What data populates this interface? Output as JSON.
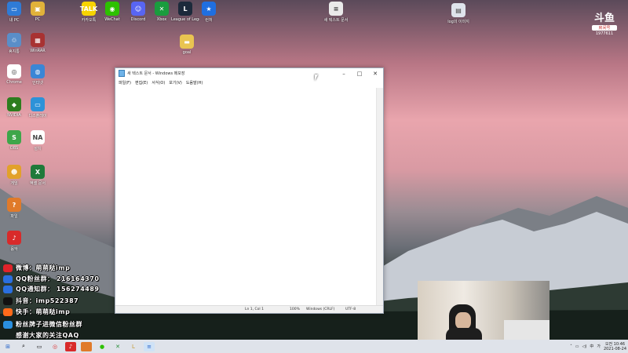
{
  "desktop_icons": [
    {
      "label": "내 PC",
      "color": "#2f7bd6",
      "glyph": "▭"
    },
    {
      "label": "PC",
      "color": "#e1b23a",
      "glyph": "▣"
    },
    {
      "label": "카카오톡",
      "color": "#f7d400",
      "glyph": "TALK"
    },
    {
      "label": "WeChat",
      "color": "#2dc100",
      "glyph": "◉"
    },
    {
      "label": "Discord",
      "color": "#5865f2",
      "glyph": "☺"
    },
    {
      "label": "Xbox",
      "color": "#1a9c3e",
      "glyph": "✕"
    },
    {
      "label": "League of Legends",
      "color": "#1c2a3b",
      "glyph": "L"
    },
    {
      "label": "런처",
      "color": "#1f6fe0",
      "glyph": "★"
    },
    {
      "label": "새 텍스트 문서",
      "color": "#eaeaea",
      "glyph": "≡"
    },
    {
      "label": "log의 이미지",
      "color": "#dfe4ec",
      "glyph": "▤"
    },
    {
      "label": "휴지통",
      "color": "#5a8ec8",
      "glyph": "♲"
    },
    {
      "label": "WinRAR",
      "color": "#a83232",
      "glyph": "▦"
    },
    {
      "label": "goal",
      "color": "#e9c451",
      "glyph": "▬"
    },
    {
      "label": "Chrome",
      "color": "#ffffff",
      "glyph": "◎"
    },
    {
      "label": "인터넷",
      "color": "#3a86d6",
      "glyph": "◍"
    },
    {
      "label": "NVIDIA",
      "color": "#2d7d1e",
      "glyph": "◆"
    },
    {
      "label": "디스플레이",
      "color": "#2d92d8",
      "glyph": "▭"
    },
    {
      "label": "OBS",
      "color": "#3ea64a",
      "glyph": "S"
    },
    {
      "label": "설치",
      "color": "#ffffff",
      "glyph": "NA"
    },
    {
      "label": "게임",
      "color": "#e2a12a",
      "glyph": "☻"
    },
    {
      "label": "엑셀 문서",
      "color": "#1f7a3a",
      "glyph": "X"
    },
    {
      "label": "파일",
      "color": "#e07a2a",
      "glyph": "?"
    },
    {
      "label": "음악",
      "color": "#d82a2a",
      "glyph": "♪"
    }
  ],
  "notepad": {
    "title": "새 텍스트 문서 - Windows 메모장",
    "menu": [
      "파일(F)",
      "편집(E)",
      "서식(O)",
      "보기(V)",
      "도움말(H)"
    ],
    "status": {
      "position": "Ln 1, Col 1",
      "zoom": "100%",
      "eol": "Windows (CRLF)",
      "encoding": "UTF-8"
    }
  },
  "overlay": [
    {
      "icon_color": "#e0232a",
      "text": "微博：萌萌哒imp"
    },
    {
      "icon_color": "#2a6fe0",
      "text": "QQ粉丝群： 216164370"
    },
    {
      "icon_color": "#2a6fe0",
      "text": "QQ通知群： 156274489"
    },
    {
      "icon_color": "#111111",
      "text": "抖音：imp522387"
    },
    {
      "icon_color": "#ff6a1a",
      "text": "快手：萌萌哒imp"
    },
    {
      "icon_color": "#2a8fe0",
      "text": "粉丝牌子进微信粉丝群"
    },
    {
      "icon_color": "transparent",
      "text": "感谢大家的关注QAQ"
    }
  ],
  "logo": {
    "brand": "斗鱼",
    "sub": "房间号",
    "room": "1977611"
  },
  "tray": {
    "lang": "中",
    "ime": "가",
    "time": "오전 10:46",
    "date": "2021-08-24"
  }
}
